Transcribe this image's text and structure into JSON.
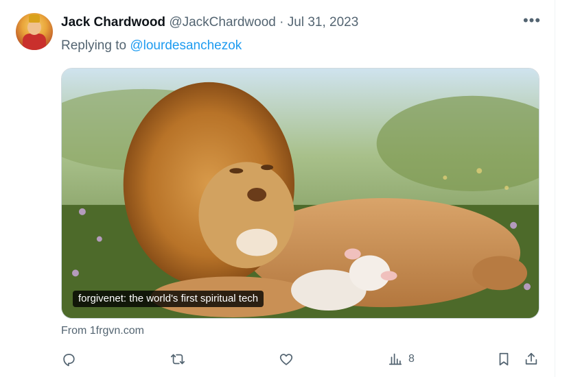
{
  "tweet": {
    "author_name": "Jack Chardwood",
    "author_handle": "@JackChardwood",
    "separator": "·",
    "date": "Jul 31, 2023",
    "replying_prefix": "Replying to ",
    "replying_mention": "@lourdesanchezok",
    "more_icon": "more-horizontal-icon"
  },
  "media": {
    "caption": "forgivenet: the world's first spiritual tech",
    "source": "From 1frgvn.com",
    "scene": "lion-and-lamb-painting"
  },
  "actions": {
    "reply_icon": "reply-icon",
    "retweet_icon": "retweet-icon",
    "like_icon": "like-icon",
    "views_icon": "views-icon",
    "views_count": "8",
    "bookmark_icon": "bookmark-icon",
    "share_icon": "share-icon"
  },
  "colors": {
    "accent": "#1d9bf0",
    "secondary_text": "#536471",
    "primary_text": "#0f1419"
  }
}
